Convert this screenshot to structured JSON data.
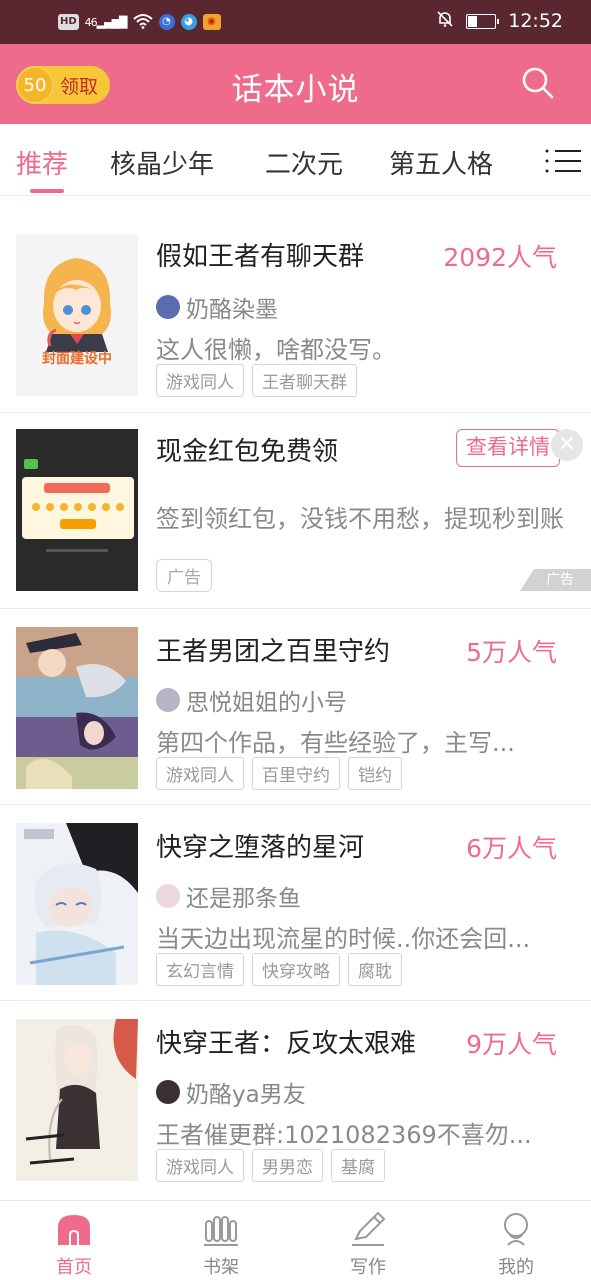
{
  "status_bar": {
    "hd": "HD",
    "signal": "46",
    "app1_icon": "messenger-icon",
    "app2_icon": "browser-icon",
    "app3_icon": "weibo-icon",
    "time": "12:52",
    "battery_level": 0.3
  },
  "header": {
    "reward_coins": "50",
    "reward_label": "领取",
    "title": "话本小说",
    "search_icon": "search-icon"
  },
  "tabs": {
    "items": [
      "推荐",
      "核晶少年",
      "二次元",
      "第五人格"
    ],
    "active_index": 0,
    "menu_icon": "menu-icon"
  },
  "items": [
    {
      "title": "假如王者有聊天群",
      "popularity": "2092人气",
      "author": "奶酪染墨",
      "description": "这人很懒，啥都没写。",
      "tags": [
        "游戏同人",
        "王者聊天群"
      ],
      "cover_text": "封面建设中"
    },
    {
      "title": "现金红包免费领",
      "detail_button": "查看详情",
      "description": "签到领红包，没钱不用愁，提现秒到账",
      "ad_label": "广告",
      "ad_badge": "广告"
    },
    {
      "title": "王者男团之百里守约",
      "popularity": "5万人气",
      "author": "思悦姐姐的小号",
      "description": "第四个作品，有些经验了，主写...",
      "tags": [
        "游戏同人",
        "百里守约",
        "铠约"
      ]
    },
    {
      "title": "快穿之堕落的星河",
      "popularity": "6万人气",
      "author": "还是那条鱼",
      "description": "当天边出现流星的时候..你还会回...",
      "tags": [
        "玄幻言情",
        "快穿攻略",
        "腐耽"
      ]
    },
    {
      "title": "快穿王者：反攻太艰难",
      "popularity": "9万人气",
      "author": "奶酪ya男友",
      "description": "王者催更群:1021082369不喜勿...",
      "tags": [
        "游戏同人",
        "男男恋",
        "基腐"
      ]
    }
  ],
  "bottom_nav": {
    "items": [
      {
        "label": "首页",
        "icon": "home-icon"
      },
      {
        "label": "书架",
        "icon": "bookshelf-icon"
      },
      {
        "label": "写作",
        "icon": "pen-icon"
      },
      {
        "label": "我的",
        "icon": "profile-icon"
      }
    ],
    "active_index": 0
  },
  "colors": {
    "accent": "#ef6b8c",
    "status_bar": "#5a2730",
    "coin": "#f7c739"
  }
}
